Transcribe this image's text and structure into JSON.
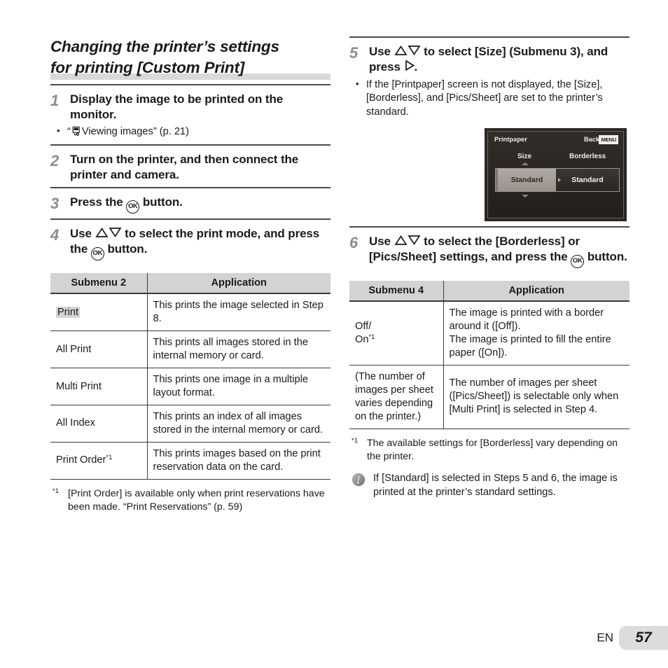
{
  "heading": {
    "line1": "Changing the printer’s settings",
    "line2": "for printing [Custom Print]"
  },
  "left_steps": [
    {
      "num": "1",
      "text_a": "Display the image to be printed on the monitor.",
      "bullets": [
        {
          "pre": "“",
          "icon": "viewing-images-icon",
          "post": "Viewing images” (p. 21)"
        }
      ]
    },
    {
      "num": "2",
      "text_a": "Turn on the printer, and then connect the printer and camera."
    },
    {
      "num": "3",
      "text_pre": "Press the ",
      "ok_label": "OK",
      "text_post": " button."
    },
    {
      "num": "4",
      "text_pre": "Use ",
      "text_mid": " to select the print mode, and press the ",
      "ok_label": "OK",
      "text_post": " button."
    }
  ],
  "table_submenu2": {
    "headers": [
      "Submenu 2",
      "Application"
    ],
    "rows": [
      {
        "label": "Print",
        "highlighted": true,
        "application": "This prints the image selected in Step 8."
      },
      {
        "label": "All Print",
        "highlighted": false,
        "application": "This prints all images stored in the internal memory or card."
      },
      {
        "label": "Multi Print",
        "highlighted": false,
        "application": "This prints one image in a multiple layout format."
      },
      {
        "label": "All Index",
        "highlighted": false,
        "application": "This prints an index of all images stored in the internal memory or card."
      },
      {
        "label": "Print Order",
        "footnote_mark": "*1",
        "highlighted": false,
        "application": "This prints images based on the print reservation data on the card."
      }
    ]
  },
  "left_footnote": {
    "mark": "*1",
    "text": "[Print Order] is available only when print reservations have been made. “Print Reservations” (p. 59)"
  },
  "right_steps": {
    "step5": {
      "num": "5",
      "text_pre": "Use ",
      "text_mid": " to select [Size] (Submenu 3), and press ",
      "text_post": ".",
      "bullets": [
        "If the [Printpaper] screen is not displayed, the [Size], [Borderless], and [Pics/Sheet] are set to the printer’s standard."
      ]
    },
    "step6": {
      "num": "6",
      "text_pre": "Use ",
      "text_mid": " to select the [Borderless] or [Pics/Sheet] settings, and press the ",
      "ok_label": "OK",
      "text_post": " button."
    }
  },
  "camera_screen": {
    "title": "Printpaper",
    "back_label": "Back",
    "menu_badge": "MENU",
    "column_labels": [
      "Size",
      "Borderless"
    ],
    "selected_value": "Standard",
    "secondary_value": "Standard"
  },
  "table_submenu4": {
    "headers": [
      "Submenu 4",
      "Application"
    ],
    "rows": [
      {
        "label_line1": "Off/",
        "label_line2": "On",
        "footnote_mark": "*1",
        "application": "The image is printed with a border around it ([Off]).\nThe image is printed to fill the entire paper ([On])."
      },
      {
        "label_line1": "(The number of images per sheet varies depending on the printer.)",
        "application": "The number of images per sheet ([Pics/Sheet]) is selectable only when [Multi Print] is selected in Step 4."
      }
    ]
  },
  "right_footnote": {
    "mark": "*1",
    "text": "The available settings for [Borderless] vary depending on the printer."
  },
  "right_note": {
    "icon": "caution-icon",
    "text": "If [Standard] is selected in Steps 5 and 6, the image is printed at the printer’s standard settings."
  },
  "footer": {
    "language": "EN",
    "page_number": "57"
  },
  "colors": {
    "table_header_bg": "#d3d3d3",
    "heading_bar": "#d9d9d9",
    "step_number": "#8e8e8e",
    "highlight": "#d5d5d5",
    "page_badge_bg": "#dcdcdc",
    "screen_bg": "#2b2622"
  }
}
